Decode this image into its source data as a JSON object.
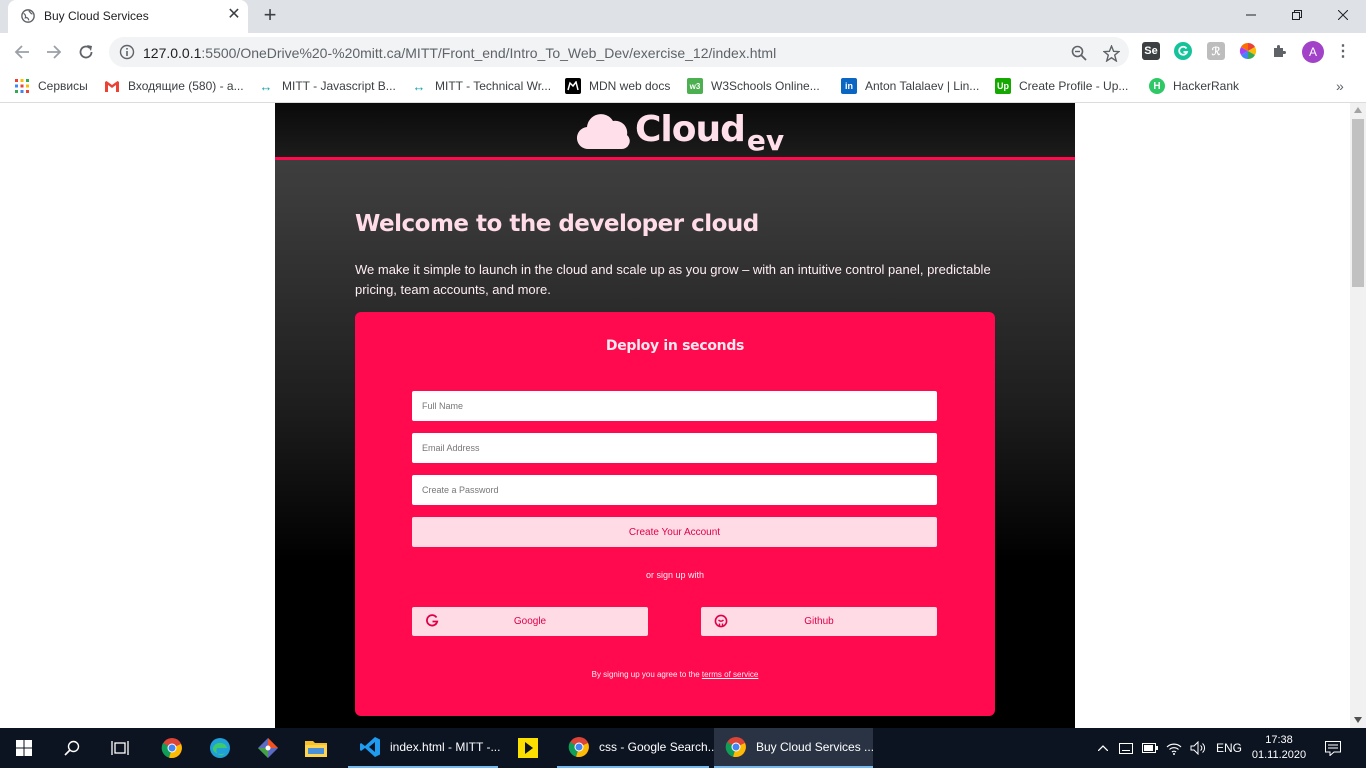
{
  "browser": {
    "tab": {
      "title": "Buy Cloud Services"
    },
    "url": {
      "host": "127.0.0.1",
      "path": ":5500/OneDrive%20-%20mitt.ca/MITT/Front_end/Intro_To_Web_Dev/exercise_12/index.html"
    },
    "bookmarks": [
      {
        "label": "Сервисы",
        "icon": "apps-icon"
      },
      {
        "label": "Входящие (580) - a...",
        "icon": "gmail-icon"
      },
      {
        "label": "MITT - Javascript B...",
        "icon": "mitt-icon"
      },
      {
        "label": "MITT - Technical Wr...",
        "icon": "mitt-icon"
      },
      {
        "label": "MDN web docs",
        "icon": "mdn-icon"
      },
      {
        "label": "W3Schools Online...",
        "icon": "w3schools-icon"
      },
      {
        "label": "Anton Talalaev | Lin...",
        "icon": "linkedin-icon"
      },
      {
        "label": "Create Profile - Up...",
        "icon": "upwork-icon"
      },
      {
        "label": "HackerRank",
        "icon": "hackerrank-icon"
      }
    ],
    "profile_initial": "A",
    "extension_labels": {
      "selenium": "Se",
      "fragment": "ℛ"
    }
  },
  "site": {
    "logo": {
      "main": "Cloud",
      "sub": "ev"
    },
    "hero": {
      "title": "Welcome to the developer cloud",
      "text": "We make it simple to launch in the cloud and scale up as you grow – with an intuitive control panel, predictable pricing, team accounts, and more."
    },
    "form": {
      "title": "Deploy in seconds",
      "full_name_placeholder": "Full Name",
      "email_placeholder": "Email Address",
      "password_placeholder": "Create a Password",
      "submit_label": "Create Your Account",
      "or_text": "or sign up with",
      "google_label": "Google",
      "github_label": "Github",
      "terms_prefix": "By signing up you agree to the ",
      "terms_link": "terms of service"
    },
    "colors": {
      "accent": "#ff0a4f",
      "button_bg": "#ffdbe5",
      "logo_pink": "#ffe0ea"
    }
  },
  "taskbar": {
    "apps": [
      {
        "label": "index.html - MITT -...",
        "icon": "vscode-icon"
      },
      {
        "label": "css - Google Search...",
        "icon": "chrome-icon"
      },
      {
        "label": "Buy Cloud Services ...",
        "icon": "chrome-icon"
      }
    ],
    "language": "ENG",
    "time": "17:38",
    "date": "01.11.2020"
  }
}
